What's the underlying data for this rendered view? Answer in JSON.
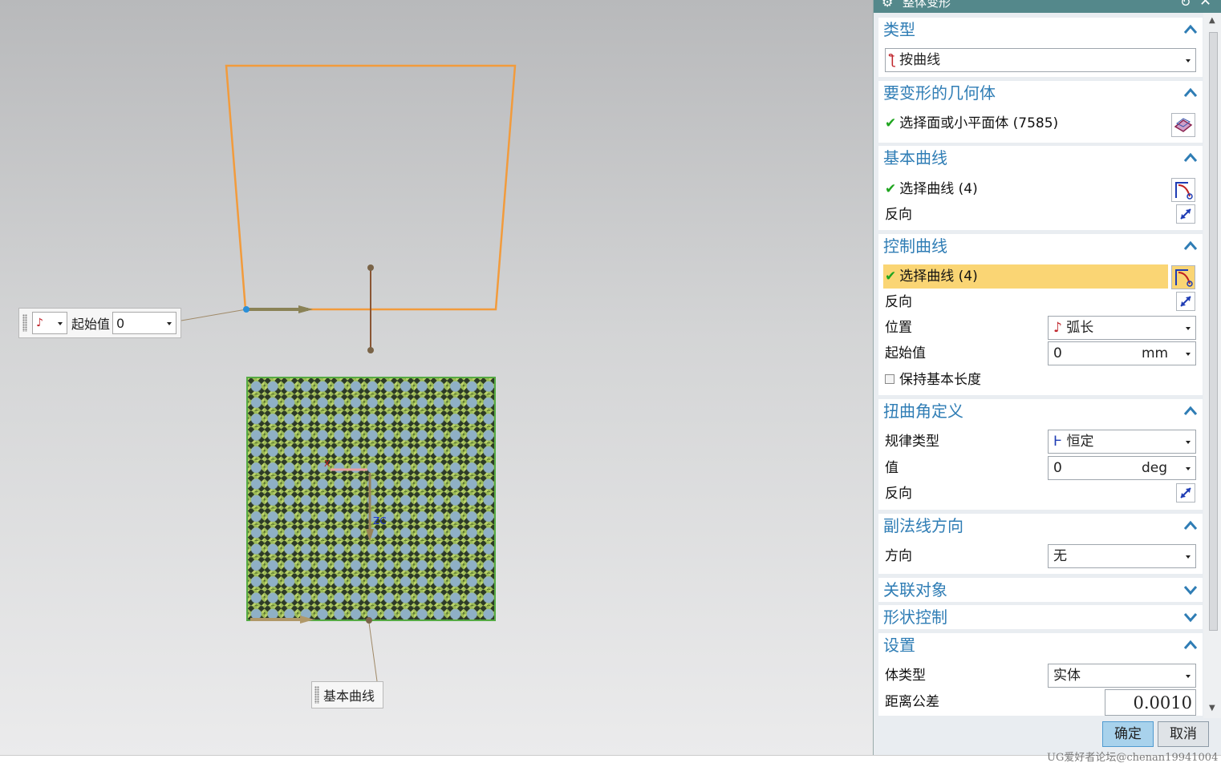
{
  "dialog": {
    "title": "整体变形",
    "sections": {
      "type": {
        "header": "类型",
        "value": "按曲线"
      },
      "geometry": {
        "header": "要变形的几何体",
        "select_label": "选择面或小平面体 (7585)"
      },
      "base_curve": {
        "header": "基本曲线",
        "select_label": "选择曲线 (4)",
        "reverse_label": "反向"
      },
      "control_curve": {
        "header": "控制曲线",
        "select_label": "选择曲线 (4)",
        "reverse_label": "反向",
        "position_label": "位置",
        "position_value": "弧长",
        "start_label": "起始值",
        "start_value": "0",
        "start_unit": "mm",
        "keep_length_label": "保持基本长度"
      },
      "twist": {
        "header": "扭曲角定义",
        "law_label": "规律类型",
        "law_value": "恒定",
        "value_label": "值",
        "value_value": "0",
        "value_unit": "deg",
        "reverse_label": "反向"
      },
      "binormal": {
        "header": "副法线方向",
        "dir_label": "方向",
        "dir_value": "无"
      },
      "associated": {
        "header": "关联对象"
      },
      "shape": {
        "header": "形状控制"
      },
      "settings": {
        "header": "设置",
        "body_type_label": "体类型",
        "body_type_value": "实体",
        "tolerance_label": "距离公差",
        "tolerance_value": "0.0010"
      }
    },
    "ok_label": "确定",
    "cancel_label": "取消"
  },
  "viewport": {
    "start_box": {
      "label": "起始值",
      "value": "0"
    },
    "base_curve_tag": "基本曲线"
  },
  "watermark": "UG爱好者论坛@chenan19941004",
  "colors": {
    "accent": "#2f7db5",
    "highlight": "#fad574",
    "titlebar": "#54888b",
    "curve": "#f29b3c"
  }
}
